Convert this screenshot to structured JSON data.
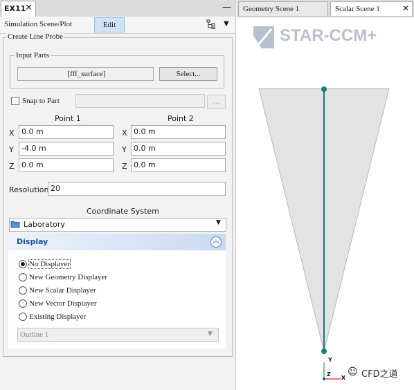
{
  "left_panel": {
    "tab_title": "EX11",
    "tab_close": "✕",
    "minimize": "—",
    "toolbar": {
      "scene_plot": "Simulation Scene/Plot",
      "edit": "Edit"
    },
    "group_title": "Create Line Probe",
    "input_parts": {
      "title": "Input Parts",
      "value": "[fff_surface]",
      "select_button": "Select..."
    },
    "snap": {
      "label": "Snap to Part",
      "button": "..."
    },
    "point1": {
      "title": "Point 1",
      "x_label": "X",
      "x": "0.0 m",
      "y_label": "Y",
      "y": "-4.0 m",
      "z_label": "Z",
      "z": "0.0 m"
    },
    "point2": {
      "title": "Point 2",
      "x_label": "X",
      "x": "0.0 m",
      "y_label": "Y",
      "y": "0.0 m",
      "z_label": "Z",
      "z": "0.0 m"
    },
    "resolution": {
      "label": "Resolution",
      "value": "20"
    },
    "coordinate_system": {
      "title": "Coordinate System",
      "value": "Laboratory"
    },
    "display": {
      "title": "Display",
      "options": [
        "No Displayer",
        "New Geometry Displayer",
        "New Scalar Displayer",
        "New Vector Displayer",
        "Existing Displayer"
      ],
      "selected_index": 0,
      "existing_select": "Outline 1"
    }
  },
  "right_panel": {
    "tabs": [
      "Geometry Scene 1",
      "Scalar Scene 1"
    ],
    "tab_close": "✕",
    "active_tab": 1,
    "logo_text": "STAR-CCM+",
    "axes": {
      "y": "Y",
      "z": "Z",
      "x": "X"
    },
    "watermark": "CFD之道"
  },
  "colors": {
    "accent_edit_bg": "#cfe3f6",
    "display_header": "#c9d8f1",
    "probe_line": "#1f6f8b",
    "probe_point": "#17806e",
    "geometry_fill": "#e3e3e3"
  }
}
